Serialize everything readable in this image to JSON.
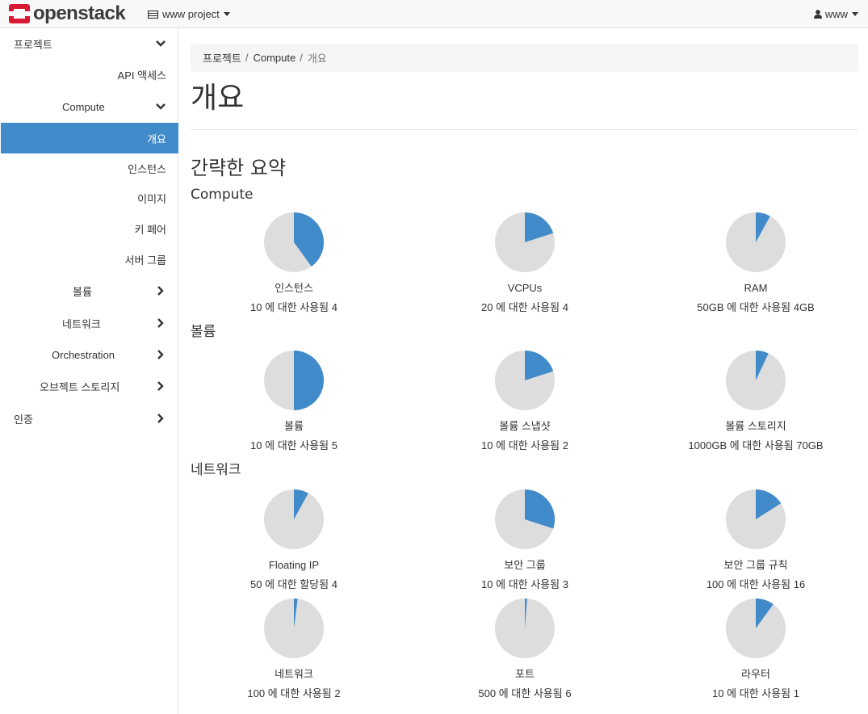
{
  "navbar": {
    "brand": "openstack",
    "project_label": "www project",
    "user_label": "www",
    "icons": {
      "logo": "openstack-logo",
      "project": "server-icon",
      "user": "user-icon",
      "caret": "caret-down-icon"
    }
  },
  "sidebar": {
    "items": [
      {
        "label": "프로젝트",
        "chevron": "down"
      },
      {
        "label": "API 액세스"
      },
      {
        "label": "Compute",
        "chevron": "down"
      },
      {
        "label": "개요",
        "active": true
      },
      {
        "label": "인스턴스"
      },
      {
        "label": "이미지"
      },
      {
        "label": "키 페어"
      },
      {
        "label": "서버 그룹"
      },
      {
        "label": "볼륨",
        "chevron": "right"
      },
      {
        "label": "네트워크",
        "chevron": "right"
      },
      {
        "label": "Orchestration",
        "chevron": "right"
      },
      {
        "label": "오브젝트 스토리지",
        "chevron": "right"
      },
      {
        "label": "인증",
        "chevron": "right"
      }
    ]
  },
  "breadcrumb": {
    "items": [
      "프로젝트",
      "Compute",
      "개요"
    ],
    "separator": "/"
  },
  "page": {
    "title": "개요",
    "section_title": "간략한 요약"
  },
  "colors": {
    "used": "#428bca",
    "free": "#dddddd",
    "active": "#428bca"
  },
  "groups": [
    {
      "title": "Compute",
      "charts": [
        {
          "name": "인스턴스",
          "usage": "10 에 대한 사용됨 4",
          "used": 4,
          "total": 10
        },
        {
          "name": "VCPUs",
          "usage": "20 에 대한 사용됨 4",
          "used": 4,
          "total": 20
        },
        {
          "name": "RAM",
          "usage": "50GB 에 대한 사용됨 4GB",
          "used": 4,
          "total": 50
        }
      ]
    },
    {
      "title": "볼륨",
      "charts": [
        {
          "name": "볼륨",
          "usage": "10 에 대한 사용됨 5",
          "used": 5,
          "total": 10
        },
        {
          "name": "볼륨 스냅샷",
          "usage": "10 에 대한 사용됨 2",
          "used": 2,
          "total": 10
        },
        {
          "name": "볼륨 스토리지",
          "usage": "1000GB 에 대한 사용됨 70GB",
          "used": 70,
          "total": 1000
        }
      ]
    },
    {
      "title": "네트워크",
      "charts": [
        {
          "name": "Floating IP",
          "usage": "50 에 대한 할당됨 4",
          "used": 4,
          "total": 50
        },
        {
          "name": "보안 그룹",
          "usage": "10 에 대한 사용됨 3",
          "used": 3,
          "total": 10
        },
        {
          "name": "보안 그룹 규칙",
          "usage": "100 에 대한 사용됨 16",
          "used": 16,
          "total": 100
        },
        {
          "name": "네트워크",
          "usage": "100 에 대한 사용됨 2",
          "used": 2,
          "total": 100
        },
        {
          "name": "포트",
          "usage": "500 에 대한 사용됨 6",
          "used": 6,
          "total": 500
        },
        {
          "name": "라우터",
          "usage": "10 에 대한 사용됨 1",
          "used": 1,
          "total": 10
        }
      ]
    }
  ]
}
